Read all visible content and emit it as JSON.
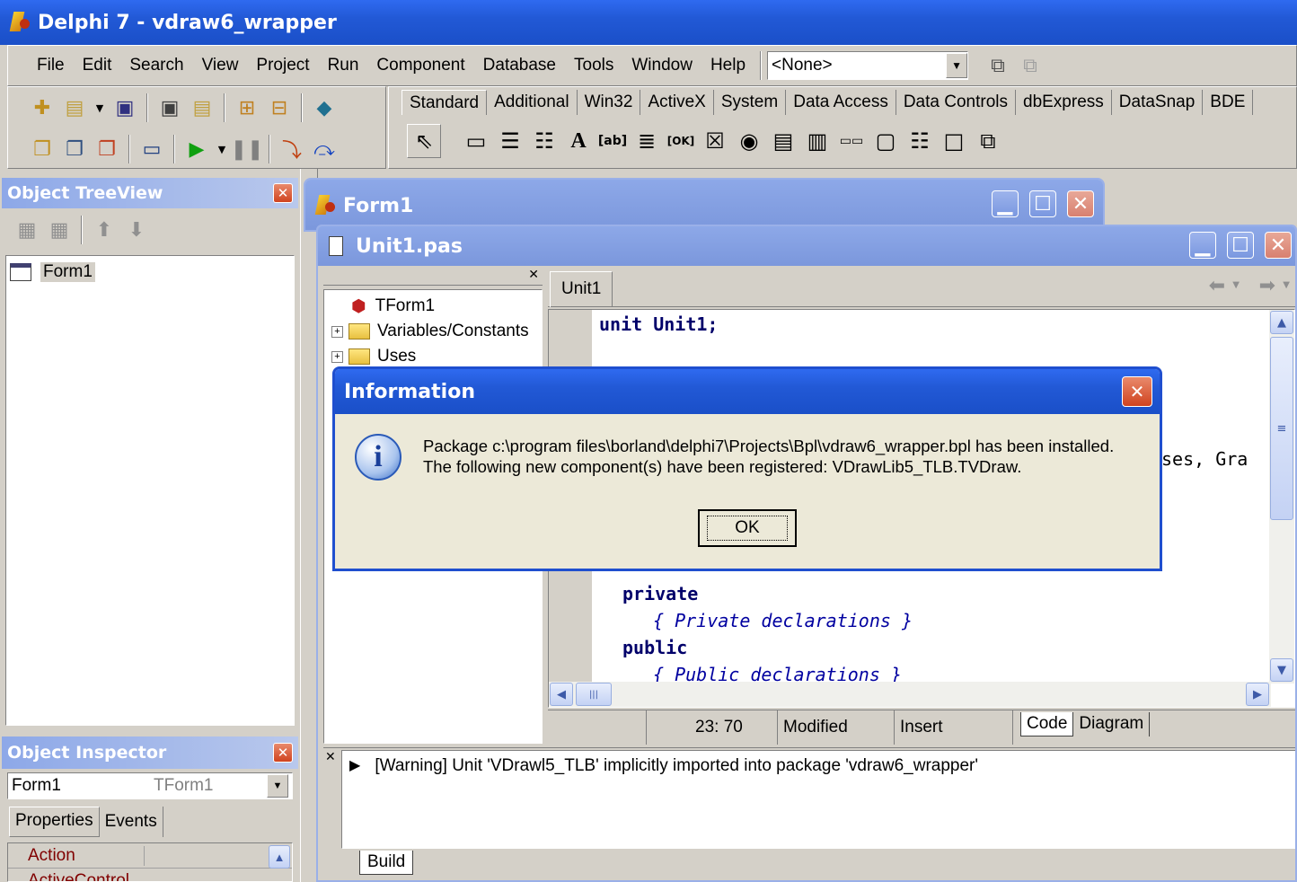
{
  "app": {
    "title": "Delphi 7 - vdraw6_wrapper"
  },
  "menu": [
    "File",
    "Edit",
    "Search",
    "View",
    "Project",
    "Run",
    "Component",
    "Database",
    "Tools",
    "Window",
    "Help"
  ],
  "toolbar": {
    "combo_value": "<None>"
  },
  "palette": {
    "tabs": [
      "Standard",
      "Additional",
      "Win32",
      "ActiveX",
      "System",
      "Data Access",
      "Data Controls",
      "dbExpress",
      "DataSnap",
      "BDE"
    ]
  },
  "treeview": {
    "title": "Object TreeView",
    "root": "Form1"
  },
  "inspector": {
    "title": "Object Inspector",
    "object_name": "Form1",
    "object_type": "TForm1",
    "tabs": [
      "Properties",
      "Events"
    ],
    "rows": [
      "Action",
      "ActiveControl"
    ]
  },
  "form_window": {
    "title": "Form1"
  },
  "editor": {
    "title": "Unit1.pas",
    "tab": "Unit1",
    "explorer": [
      "TForm1",
      "Variables/Constants",
      "Uses"
    ],
    "code_top": "unit Unit1;",
    "code_fragment": "ses, Gra",
    "code_private": "private",
    "code_private_comment": "{ Private declarations }",
    "code_public": "public",
    "code_public_comment": "{ Public declarations }",
    "status": {
      "position": "23:  70",
      "modified": "Modified",
      "mode": "Insert",
      "tabs": [
        "Code",
        "Diagram"
      ]
    }
  },
  "messages": {
    "warning": "[Warning] Unit 'VDrawl5_TLB' implicitly imported into package 'vdraw6_wrapper'",
    "tab": "Build"
  },
  "dialog": {
    "title": "Information",
    "line1": "Package c:\\program files\\borland\\delphi7\\Projects\\Bpl\\vdraw6_wrapper.bpl has been installed.",
    "line2": "The following new component(s) have been registered: VDrawLib5_TLB.TVDraw.",
    "ok": "OK"
  }
}
